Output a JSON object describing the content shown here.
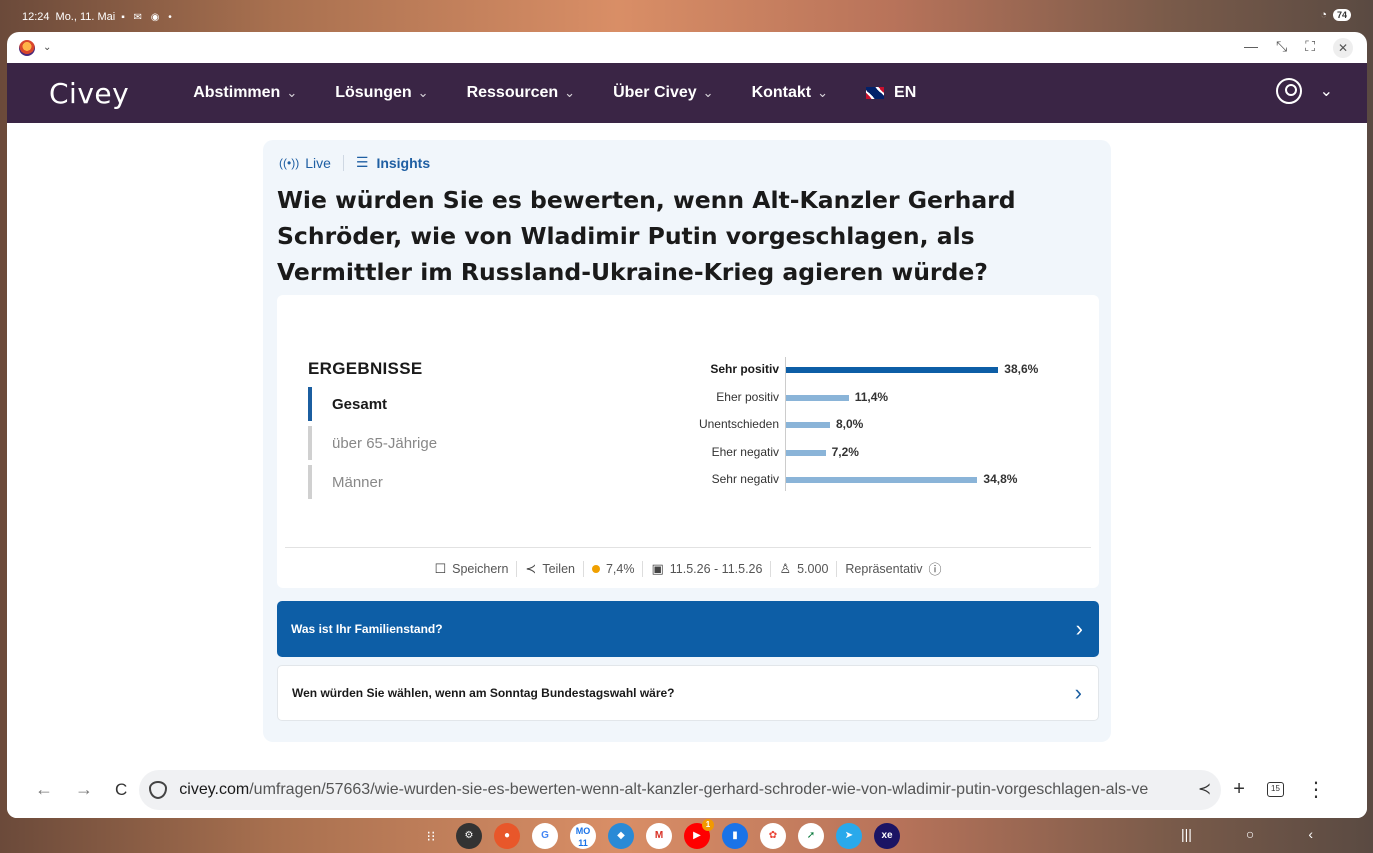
{
  "statusbar": {
    "time": "12:24",
    "date": "Mo., 11. Mai",
    "battery": "74"
  },
  "nav": {
    "logo": "Civey",
    "items": [
      {
        "label": "Abstimmen"
      },
      {
        "label": "Lösungen"
      },
      {
        "label": "Ressourcen"
      },
      {
        "label": "Über Civey"
      },
      {
        "label": "Kontakt"
      }
    ],
    "lang": "EN"
  },
  "card": {
    "live_label": "Live",
    "insights_label": "Insights",
    "question": "Wie würden Sie es bewerten, wenn Alt-Kanzler Gerhard Schröder, wie von Wladimir Putin vorgeschlagen, als Vermittler im Russland-Ukraine-Krieg agieren würde?"
  },
  "results": {
    "title": "ERGEBNISSE",
    "filters": [
      {
        "label": "Gesamt",
        "active": true
      },
      {
        "label": "über 65-Jährige",
        "active": false
      },
      {
        "label": "Männer",
        "active": false
      }
    ]
  },
  "chart_data": {
    "type": "bar",
    "orientation": "horizontal",
    "categories": [
      "Sehr positiv",
      "Eher positiv",
      "Unentschieden",
      "Eher negativ",
      "Sehr negativ"
    ],
    "values": [
      38.6,
      11.4,
      8.0,
      7.2,
      34.8
    ],
    "value_labels": [
      "38,6%",
      "11,4%",
      "8,0%",
      "7,2%",
      "34,8%"
    ],
    "highlight_index": 0,
    "colors": {
      "highlight": "#0d5ea6",
      "normal": "#8ab4d8"
    },
    "xlim": [
      0,
      40
    ]
  },
  "meta": {
    "save": "Speichern",
    "share": "Teilen",
    "error_margin": "7,4%",
    "period": "11.5.26 - 11.5.26",
    "respondents": "5.000",
    "representative": "Repräsentativ"
  },
  "next_questions": [
    {
      "label": "Was ist Ihr Familienstand?"
    },
    {
      "label": "Wen würden Sie wählen, wenn am Sonntag Bundestagswahl wäre?"
    }
  ],
  "browser": {
    "url_host": "civey.com",
    "url_path": "/umfragen/57663/wie-wurden-sie-es-bewerten-wenn-alt-kanzler-gerhard-schroder-wie-von-wladimir-putin-vorgeschlagen-als-ve",
    "tab_count": "15"
  },
  "dock": {
    "calendar_day": "11",
    "calendar_weekday": "MO",
    "youtube_badge": "1"
  },
  "colors": {
    "nav_bg": "#3a2545",
    "accent": "#0d5ea6",
    "card_bg": "#f1f6fb"
  }
}
